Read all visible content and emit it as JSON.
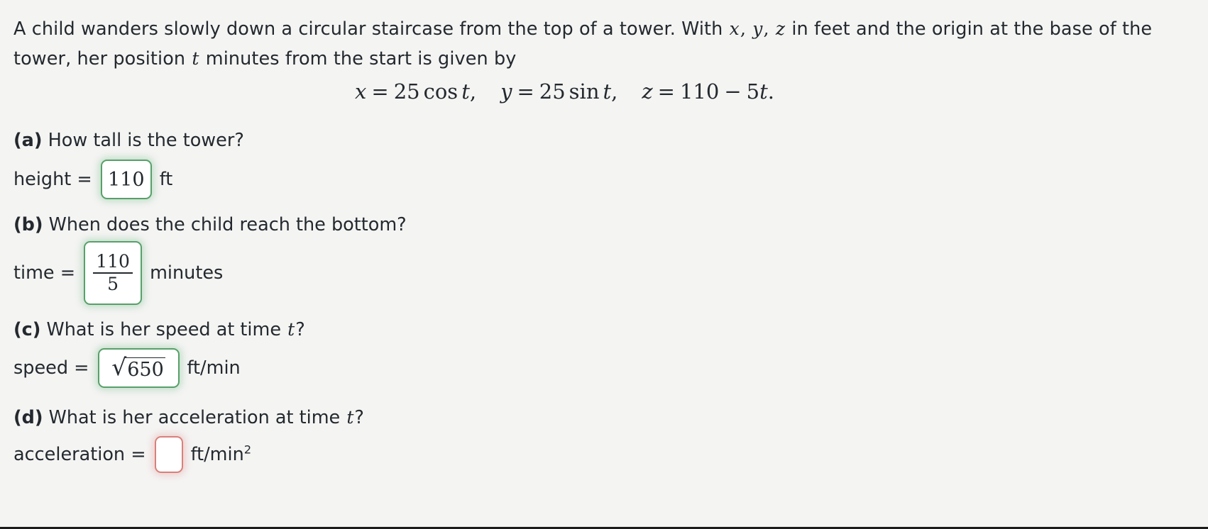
{
  "problem": {
    "stem_part1": "A child wanders slowly down a circular staircase from the top of a tower. With ",
    "var_x": "x",
    "comma1": ", ",
    "var_y": "y",
    "comma2": ", ",
    "var_z": "z",
    "stem_part2": " in feet and the origin at the base of the tower, her position ",
    "var_t": "t",
    "stem_part3": " minutes from the start is given by"
  },
  "equation": {
    "x_lhs": "x",
    "eq1": "=",
    "x_rhs_coeff": "25",
    "x_rhs_fn": "cos",
    "x_rhs_var": "t",
    "comma1": ",",
    "y_lhs": "y",
    "eq2": "=",
    "y_rhs_coeff": "25",
    "y_rhs_fn": "sin",
    "y_rhs_var": "t",
    "comma2": ",",
    "z_lhs": "z",
    "eq3": "=",
    "z_rhs_const": "110",
    "z_rhs_op": "−",
    "z_rhs_coeff": "5",
    "z_rhs_var": "t",
    "period": "."
  },
  "parts": {
    "a": {
      "tag": "(a)",
      "prompt": " How tall is the tower?",
      "answer_label": "height =",
      "answer_value": "110",
      "unit": "ft",
      "status": "correct",
      "status_color": "#57a06a"
    },
    "b": {
      "tag": "(b)",
      "prompt": " When does the child reach the bottom?",
      "answer_label": "time =",
      "answer_numerator": "110",
      "answer_denominator": "5",
      "unit": "minutes",
      "status": "correct",
      "status_color": "#57a06a"
    },
    "c": {
      "tag": "(c)",
      "prompt_before": " What is her speed at time ",
      "prompt_var": "t",
      "prompt_after": "?",
      "answer_label": "speed =",
      "answer_radical": "√",
      "answer_radicand": "650",
      "unit": "ft/min",
      "status": "correct",
      "status_color": "#57a06a"
    },
    "d": {
      "tag": "(d)",
      "prompt_before": " What is her acceleration at time ",
      "prompt_var": "t",
      "prompt_after": "?",
      "answer_label": "acceleration =",
      "answer_value": "",
      "unit_base": "ft/min",
      "unit_exponent": "2",
      "status": "incorrect",
      "status_color": "#d9807c"
    }
  },
  "colors": {
    "background": "#f4f4f3",
    "text": "#23292e",
    "correct_border": "#57a06a",
    "incorrect_border": "#d9807c",
    "field_background": "#ffffff",
    "bottom_rule": "#1c1c1c"
  }
}
